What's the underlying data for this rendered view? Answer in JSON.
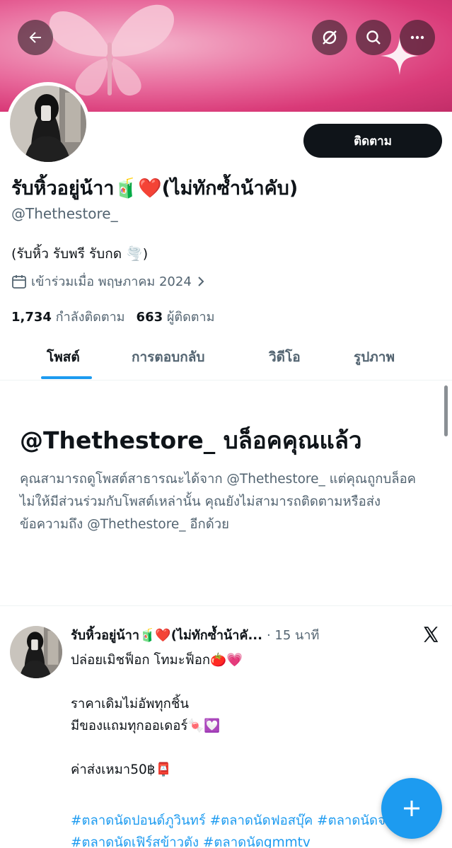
{
  "header": {
    "back_icon": "arrow-left-icon",
    "translate_icon": "slashed-circle-icon",
    "search_icon": "search-icon",
    "more_icon": "more-dots-icon",
    "banner_colors": [
      "#f4b6cd",
      "#e86a9c",
      "#d93a78"
    ]
  },
  "profile": {
    "follow_label": "ติดตาม",
    "display_name": "รับหิ้วอยู่น้าา🧃❤️(ไม่ทักซ้ำน้าคับ)",
    "handle": "@Thethestore_",
    "bio": "(รับหิ้ว รับพรี รับกด 🌪️)",
    "joined": "เข้าร่วมเมื่อ พฤษภาคม 2024",
    "following_count": "1,734",
    "following_label": "กำลังติดตาม",
    "followers_count": "663",
    "followers_label": "ผู้ติดตาม"
  },
  "tabs": [
    {
      "label": "โพสต์",
      "active": true
    },
    {
      "label": "การตอบกลับ",
      "active": false
    },
    {
      "label": "วิดีโอ",
      "active": false
    },
    {
      "label": "รูปภาพ",
      "active": false
    }
  ],
  "blocked": {
    "title": "@Thethestore_ บล็อคคุณแล้ว",
    "body": "คุณสามารถดูโพสต์สาธารณะได้จาก @Thethestore_ แต่คุณถูกบล็อคไม่ให้มีส่วนร่วมกับโพสต์เหล่านั้น คุณยังไม่สามารถติดตามหรือส่งข้อความถึง @Thethestore_ อีกด้วย"
  },
  "post": {
    "author": "รับหิ้วอยู่น้าา🧃❤️(ไม่ทักซ้ำน้าคั...",
    "time": "· 15 นาที",
    "lines": [
      "ปล่อยเมิชฟ็อก โทมะฟ็อก🍅💗",
      "",
      "ราคาเดิมไม่อัพทุกชิ้น",
      "มีของแถมทุกออเดอร์🍬💟",
      "",
      "ค่าส่งเหมา50฿📮"
    ],
    "hashtags": "#ตลาดนัดปอนด์ภูวินทร์ #ตลาดนัดฟอสบุ๊ค #ตลาดนัดจงดัง #ตลาดนัดเฟิร์สข้าวตัง #ตลาดนัดgmmtv"
  },
  "fab_icon": "plus-icon",
  "accent_color": "#1d9bf0"
}
